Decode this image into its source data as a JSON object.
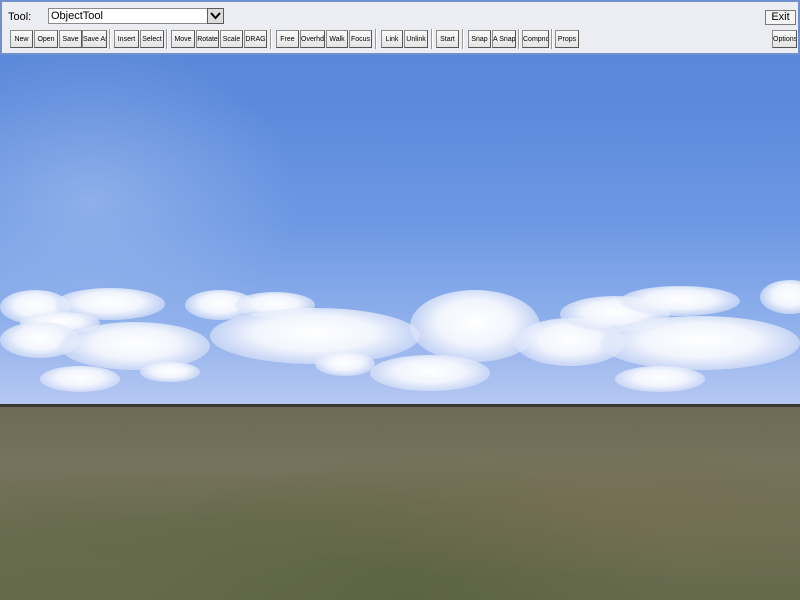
{
  "toolbar": {
    "tool_label": "Tool:",
    "selected_tool": "ObjectTool",
    "dropdown_icon": "chevron-down-icon",
    "exit_label": "Exit",
    "groups": [
      {
        "buttons": [
          "New",
          "Open",
          "Save",
          "Save As"
        ]
      },
      {
        "buttons": [
          "Insert",
          "Select"
        ]
      },
      {
        "buttons": [
          "Move",
          "Rotate",
          "Scale",
          "DRAG"
        ]
      },
      {
        "buttons": [
          "Free",
          "Overhd",
          "Walk",
          "Focus"
        ]
      },
      {
        "buttons": [
          "Link",
          "Unlink"
        ]
      },
      {
        "buttons": [
          "Start"
        ]
      },
      {
        "buttons": [
          "Snap",
          "A Snap"
        ]
      },
      {
        "buttons": [
          "Compnd"
        ]
      },
      {
        "buttons": [
          "Props"
        ]
      }
    ],
    "options_label": "Options"
  },
  "scene": {
    "sky_color": "#5b89db",
    "ground_color": "#74715a",
    "horizon_color": "#3a3a34"
  }
}
